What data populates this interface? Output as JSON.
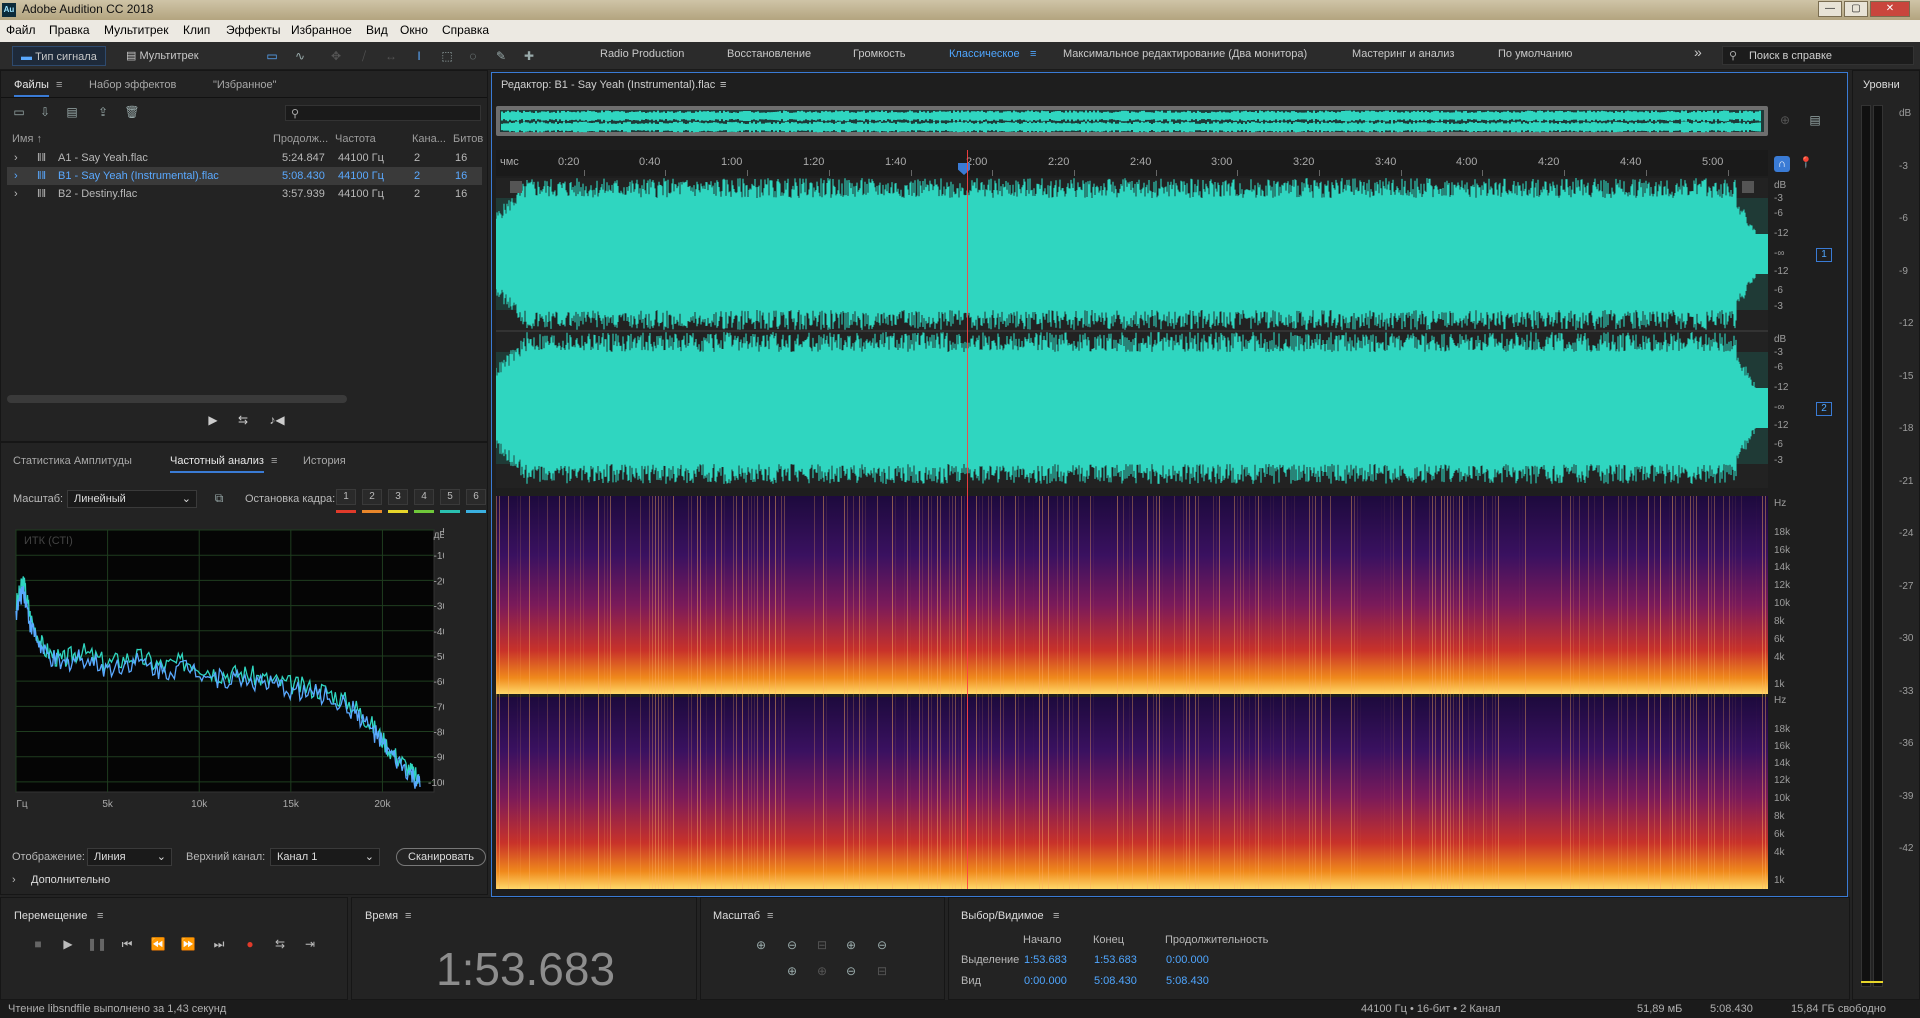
{
  "window": {
    "title": "Adobe Audition CC 2018",
    "app_icon": "Au",
    "controls": [
      "—",
      "▢",
      "✕"
    ]
  },
  "menu": [
    "Файл",
    "Правка",
    "Мультитрек",
    "Клип",
    "Эффекты",
    "Избранное",
    "Вид",
    "Окно",
    "Справка"
  ],
  "toolbar": {
    "waveform_view": "Тип сигнала",
    "multitrack_view": "Мультитрек",
    "workspaces": [
      "Radio Production",
      "Восстановление",
      "Громкость",
      "Классическое",
      "Максимальное редактирование (Два монитора)",
      "Мастеринг и анализ",
      "По умолчанию"
    ],
    "active_workspace": "Классическое",
    "search_placeholder": "Поиск в справке",
    "overflow": "»"
  },
  "files_panel": {
    "tabs": [
      "Файлы",
      "Набор эффектов",
      "\"Избранное\""
    ],
    "columns": [
      "Имя",
      "Продолж...",
      "Частота",
      "Кана...",
      "Битов"
    ],
    "rows": [
      {
        "name": "A1 - Say Yeah.flac",
        "duration": "5:24.847",
        "rate": "44100 Гц",
        "channels": "2",
        "bits": "16",
        "selected": false
      },
      {
        "name": "B1 - Say Yeah (Instrumental).flac",
        "duration": "5:08.430",
        "rate": "44100 Гц",
        "channels": "2",
        "bits": "16",
        "selected": true
      },
      {
        "name": "B2 - Destiny.flac",
        "duration": "3:57.939",
        "rate": "44100 Гц",
        "channels": "2",
        "bits": "16",
        "selected": false
      }
    ]
  },
  "analysis_panel": {
    "tabs": [
      "Статистика Амплитуды",
      "Частотный анализ",
      "История"
    ],
    "scale_label": "Масштаб:",
    "scale_value": "Линейный",
    "freeze_label": "Остановка кадра:",
    "freeze_slots": [
      "1",
      "2",
      "3",
      "4",
      "5",
      "6"
    ],
    "freeze_colors": [
      "#e03a2a",
      "#e8862a",
      "#e6d52a",
      "#6fc83a",
      "#2ac0b0",
      "#3ab0e0"
    ],
    "chart_corner": "ИТК (СТI)",
    "display_label": "Отображение:",
    "display_value": "Линия",
    "channel_label": "Верхний канал:",
    "channel_value": "Канал 1",
    "scan_button": "Сканировать",
    "more": "Дополнительно"
  },
  "chart_data": {
    "type": "line",
    "title": "",
    "ylabel": "дБ",
    "xlabel": "",
    "x_ticks": [
      "Гц",
      "5k",
      "10k",
      "15k",
      "20k"
    ],
    "y_ticks": [
      "0",
      "-10",
      "-20",
      "-30",
      "-40",
      "-50",
      "-60",
      "-70",
      "-80",
      "-90",
      "-100"
    ],
    "ylim": [
      -104,
      0
    ],
    "xlim": [
      0,
      22050
    ],
    "series": [
      {
        "color": "#2fd6c0",
        "x": [
          0,
          400,
          800,
          1500,
          2500,
          3500,
          5000,
          6500,
          8000,
          9500,
          11000,
          12500,
          14000,
          15500,
          17000,
          18500,
          19500,
          20500,
          21500,
          22050
        ],
        "y": [
          -30,
          -20,
          -35,
          -47,
          -52,
          -48,
          -53,
          -50,
          -54,
          -52,
          -57,
          -57,
          -60,
          -62,
          -64,
          -70,
          -78,
          -88,
          -95,
          -100
        ]
      },
      {
        "color": "#5aa9ff",
        "x": [
          0,
          400,
          800,
          1500,
          2500,
          3500,
          5000,
          6500,
          8000,
          9500,
          11000,
          12500,
          14000,
          15500,
          17000,
          18500,
          19500,
          20500,
          21500,
          22050
        ],
        "y": [
          -33,
          -23,
          -38,
          -49,
          -54,
          -50,
          -55,
          -52,
          -56,
          -54,
          -59,
          -59,
          -62,
          -64,
          -66,
          -72,
          -80,
          -90,
          -97,
          -102
        ]
      }
    ]
  },
  "editor": {
    "title": "Редактор: B1 - Say Yeah (Instrumental).flac",
    "time_unit": "чмс",
    "time_ticks": [
      "0:20",
      "0:40",
      "1:00",
      "1:20",
      "1:40",
      "2:00",
      "2:20",
      "2:40",
      "3:00",
      "3:20",
      "3:40",
      "4:00",
      "4:20",
      "4:40",
      "5:00"
    ],
    "db_ticks": [
      "dB",
      "-3",
      "-6",
      "-12",
      "-∞",
      "-12",
      "-6",
      "-3"
    ],
    "channel_badges": [
      "1",
      "2"
    ],
    "hz_ticks": [
      "Hz",
      "18k",
      "16k",
      "14k",
      "12k",
      "10k",
      "8k",
      "6k",
      "4k",
      "1k"
    ],
    "waveform_color": "#2fd6c0",
    "playhead_fraction": 0.369
  },
  "levels": {
    "title": "Уровни",
    "ticks": [
      "dB",
      "-3",
      "-6",
      "-9",
      "-12",
      "-15",
      "-18",
      "-21",
      "-24",
      "-27",
      "-30",
      "-33",
      "-36",
      "-39",
      "-42"
    ]
  },
  "transport": {
    "title": "Перемещение",
    "buttons": [
      "stop-icon",
      "play-icon",
      "pause-icon",
      "goto-start-icon",
      "rewind-icon",
      "fast-forward-icon",
      "goto-end-icon",
      "record-icon",
      "loop-icon",
      "skip-icon"
    ]
  },
  "time_panel": {
    "title": "Время",
    "value": "1:53.683"
  },
  "zoom_panel": {
    "title": "Масштаб"
  },
  "selection_panel": {
    "title": "Выбор/Видимое",
    "headers": [
      "Начало",
      "Конец",
      "Продолжительность"
    ],
    "rows": [
      {
        "label": "Выделение",
        "start": "1:53.683",
        "end": "1:53.683",
        "duration": "0:00.000"
      },
      {
        "label": "Вид",
        "start": "0:00.000",
        "end": "5:08.430",
        "duration": "5:08.430"
      }
    ]
  },
  "status": {
    "message": "Чтение libsndfile выполнено за 1,43 секунд",
    "format": "44100 Гц • 16-бит • 2 Канал",
    "size": "51,89 мБ",
    "duration": "5:08.430",
    "free": "15,84 ГБ свободно"
  }
}
